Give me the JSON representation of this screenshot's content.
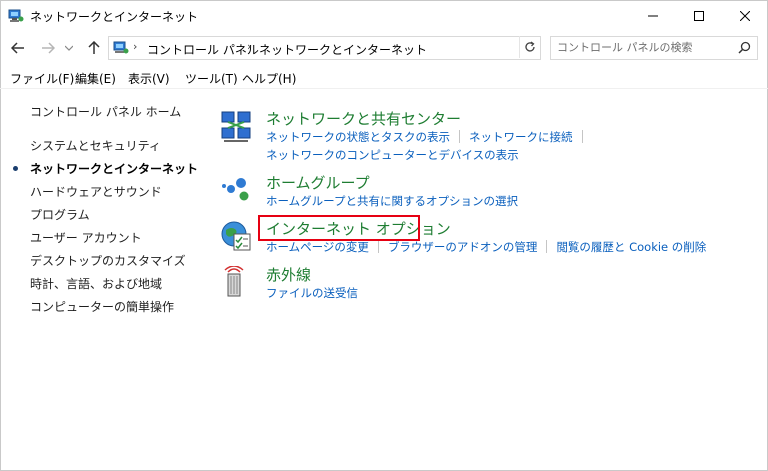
{
  "window": {
    "title": "ネットワークとインターネット",
    "title_icon": "control-panel-network-icon"
  },
  "nav": {
    "back_icon": "back-arrow-icon",
    "forward_icon": "forward-arrow-icon",
    "recent_icon": "chevron-down-icon",
    "up_icon": "up-arrow-icon",
    "breadcrumb": [
      "コントロール パネル",
      "ネットワークとインターネット"
    ],
    "search_placeholder": "コントロール パネルの検索"
  },
  "menu": [
    "ファイル(F)",
    "編集(E)",
    "表示(V)",
    "ツール(T)",
    "ヘルプ(H)"
  ],
  "left_nav": {
    "home": "コントロール パネル ホーム",
    "items": [
      "システムとセキュリティ",
      "ネットワークとインターネット",
      "ハードウェアとサウンド",
      "プログラム",
      "ユーザー アカウント",
      "デスクトップのカスタマイズ",
      "時計、言語、および地域",
      "コンピューターの簡単操作"
    ],
    "current_index": 1
  },
  "sections": [
    {
      "title": "ネットワークと共有センター",
      "icon": "network-sharing-center-icon",
      "links_row1": [
        "ネットワークの状態とタスクの表示",
        "ネットワークに接続"
      ],
      "links_row2": [
        "ネットワークのコンピューターとデバイスの表示"
      ]
    },
    {
      "title": "ホームグループ",
      "icon": "homegroup-icon",
      "links_row1": [
        "ホームグループと共有に関するオプションの選択"
      ]
    },
    {
      "title": "インターネット オプション",
      "icon": "internet-options-icon",
      "links_row1": [
        "ホームページの変更",
        "ブラウザーのアドオンの管理",
        "閲覧の履歴と Cookie の削除"
      ],
      "highlighted": true
    },
    {
      "title": "赤外線",
      "icon": "infrared-icon",
      "links_row1": [
        "ファイルの送受信"
      ]
    }
  ],
  "colors": {
    "section_title": "#1e7d32",
    "link": "#0a5fbd",
    "highlight_border": "#e60012"
  }
}
